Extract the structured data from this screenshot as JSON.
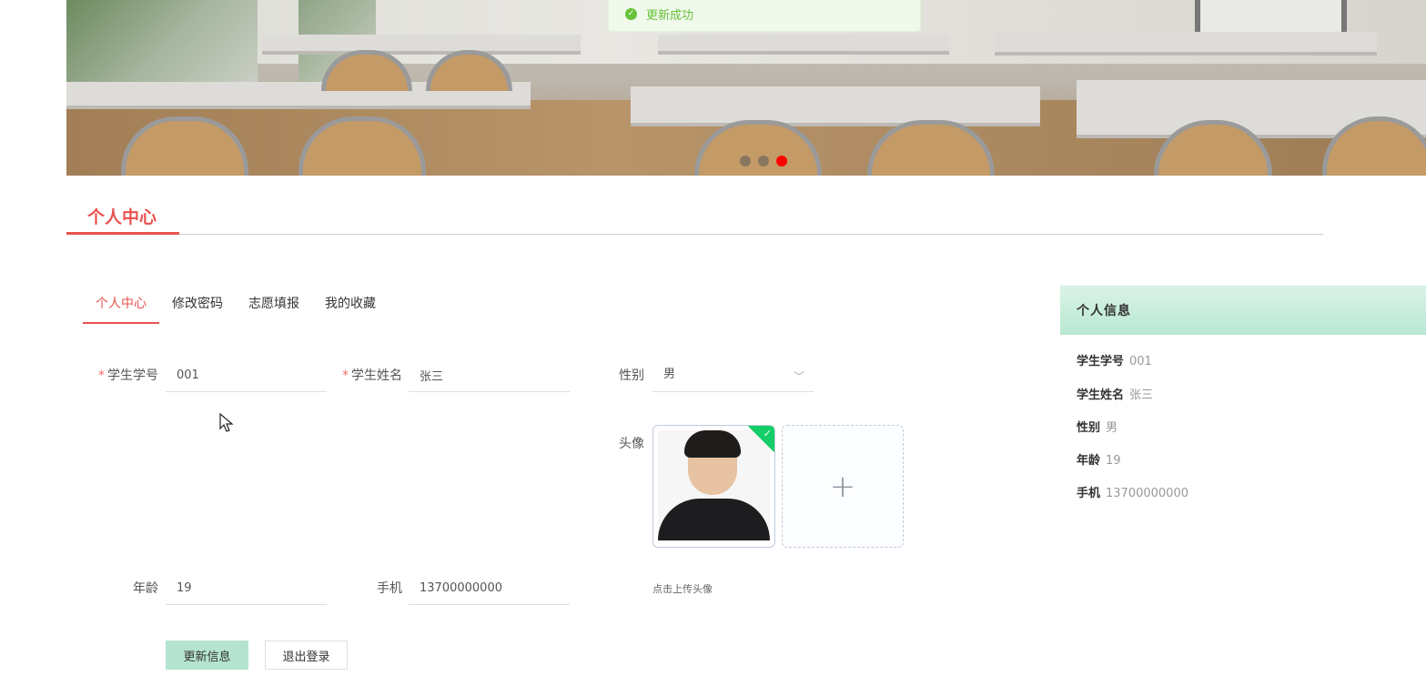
{
  "banner": {
    "active_dot": 3
  },
  "toast": {
    "icon": "check-circle-icon",
    "message": "更新成功",
    "color": "#67c23a"
  },
  "section": {
    "title": "个人中心",
    "accent_color": "#e8534f"
  },
  "tabs": [
    {
      "label": "个人中心",
      "active": true
    },
    {
      "label": "修改密码",
      "active": false
    },
    {
      "label": "志愿填报",
      "active": false
    },
    {
      "label": "我的收藏",
      "active": false
    }
  ],
  "form": {
    "student_id": {
      "label": "学生学号",
      "value": "001",
      "required": true
    },
    "student_name": {
      "label": "学生姓名",
      "value": "张三",
      "required": true
    },
    "gender": {
      "label": "性别",
      "value": "男"
    },
    "avatar": {
      "label": "头像",
      "tip": "点击上传头像"
    },
    "age": {
      "label": "年龄",
      "value": "19"
    },
    "phone": {
      "label": "手机",
      "value": "13700000000"
    }
  },
  "buttons": {
    "update": "更新信息",
    "logout": "退出登录"
  },
  "info_panel": {
    "title": "个人信息",
    "rows": [
      {
        "key": "学生学号",
        "value": "001"
      },
      {
        "key": "学生姓名",
        "value": "张三"
      },
      {
        "key": "性别",
        "value": "男"
      },
      {
        "key": "年龄",
        "value": "19"
      },
      {
        "key": "手机",
        "value": "13700000000"
      }
    ]
  }
}
